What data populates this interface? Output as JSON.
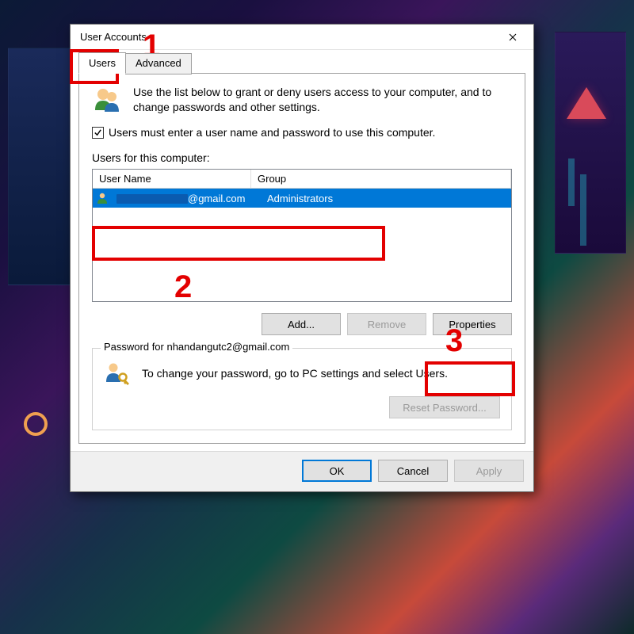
{
  "window": {
    "title": "User Accounts",
    "close_tooltip": "Close"
  },
  "tabs": {
    "users": "Users",
    "advanced": "Advanced"
  },
  "intro_text": "Use the list below to grant or deny users access to your computer, and to change passwords and other settings.",
  "checkbox_label": "Users must enter a user name and password to use this computer.",
  "checkbox_checked": true,
  "list_label": "Users for this computer:",
  "columns": {
    "user": "User Name",
    "group": "Group"
  },
  "rows": [
    {
      "user_suffix": "@gmail.com",
      "group": "Administrators"
    }
  ],
  "buttons": {
    "add": "Add...",
    "remove": "Remove",
    "properties": "Properties"
  },
  "password_section": {
    "legend": "Password for nhandangutc2@gmail.com",
    "text": "To change your password, go to PC settings and select Users.",
    "reset": "Reset Password..."
  },
  "dialog_buttons": {
    "ok": "OK",
    "cancel": "Cancel",
    "apply": "Apply"
  },
  "annotations": {
    "n1": "1",
    "n2": "2",
    "n3": "3"
  }
}
